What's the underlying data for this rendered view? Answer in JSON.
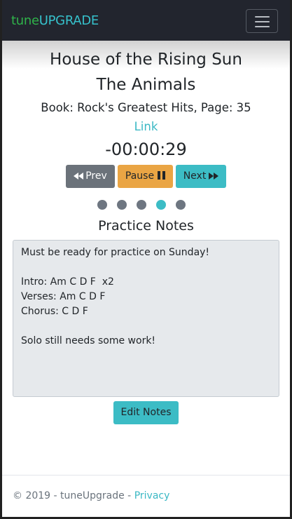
{
  "navbar": {
    "brand_part1": "tune",
    "brand_part2": "UPGRADE",
    "menu_icon": "hamburger-menu-icon",
    "brand_colors": {
      "tune": "#2fb34a",
      "upgrade": "#36c1cb"
    }
  },
  "song": {
    "title": "House of the Rising Sun",
    "artist": "The Animals",
    "book_info": "Book: Rock's Greatest Hits, Page: 35",
    "link_label": "Link",
    "timer": "-00:00:29"
  },
  "controls": {
    "prev_label": "Prev",
    "pause_label": "Pause",
    "next_label": "Next",
    "prev_icon": "rewind-icon",
    "pause_icon": "pause-icon",
    "next_icon": "fast-forward-icon"
  },
  "progress": {
    "total": 5,
    "active_index": 3
  },
  "notes": {
    "heading": "Practice Notes",
    "text": "Must be ready for practice on Sunday!\n\nIntro: Am C D F  x2\nVerses: Am C D F\nChorus: C D F\n\nSolo still needs some work!",
    "edit_label": "Edit Notes"
  },
  "footer": {
    "copyright": "© 2019 - tuneUpgrade - ",
    "privacy_label": "Privacy"
  },
  "colors": {
    "navbar_bg": "#22252e",
    "accent": "#3cbcc5",
    "pause": "#eaa544",
    "prev": "#6b727a"
  }
}
